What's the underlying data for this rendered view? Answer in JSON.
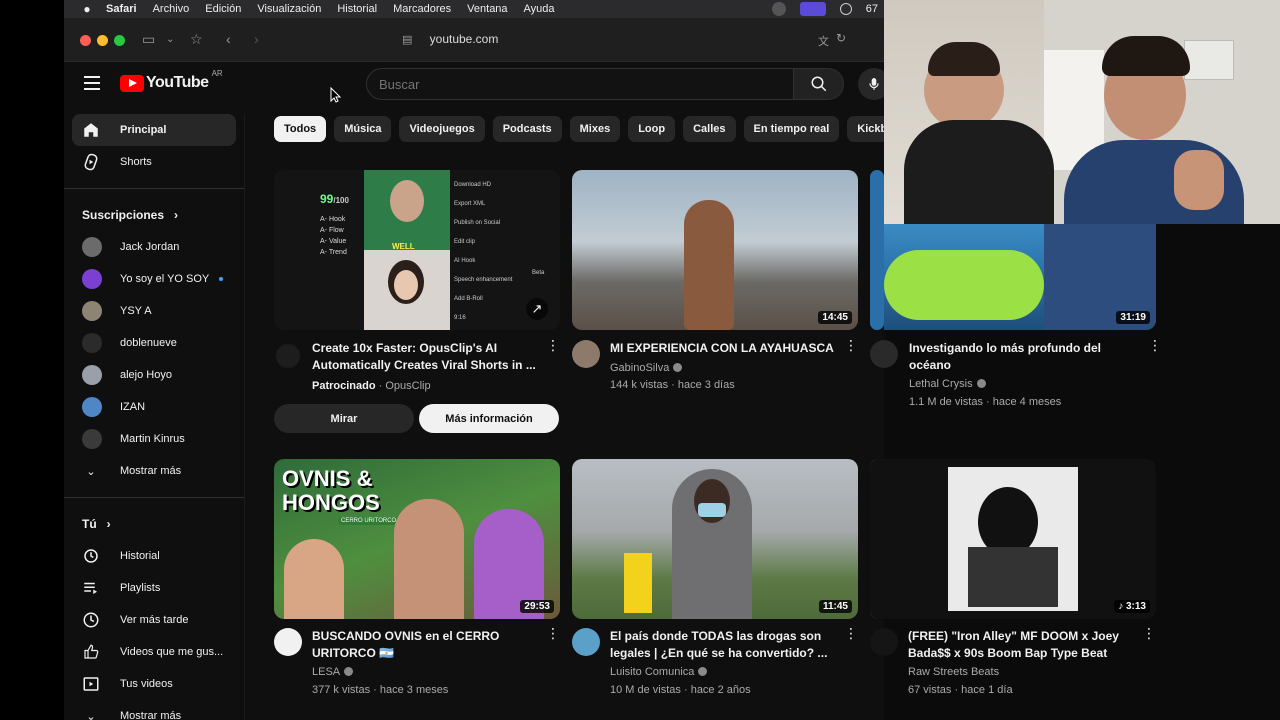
{
  "menubar": {
    "app": "Safari",
    "items": [
      "Archivo",
      "Edición",
      "Visualización",
      "Historial",
      "Marcadores",
      "Ventana",
      "Ayuda"
    ],
    "right_text": "67"
  },
  "browser": {
    "url": "youtube.com"
  },
  "youtube": {
    "logo_text": "YouTube",
    "region": "AR",
    "search_placeholder": "Buscar"
  },
  "sidebar": {
    "main": [
      {
        "label": "Principal",
        "icon": "home-icon",
        "active": true
      },
      {
        "label": "Shorts",
        "icon": "shorts-icon",
        "active": false
      }
    ],
    "subscriptions_title": "Suscripciones",
    "subscriptions": [
      {
        "label": "Jack Jordan",
        "color": "#6b6b6b"
      },
      {
        "label": "Yo soy el YO SOY",
        "color": "#7b3fd1",
        "new": true
      },
      {
        "label": "YSY A",
        "color": "#8c8573"
      },
      {
        "label": "doblenueve",
        "color": "#2b2b2b"
      },
      {
        "label": "alejo Hoyo",
        "color": "#9aa0a8"
      },
      {
        "label": "IZAN",
        "color": "#4f86c6"
      },
      {
        "label": "Martin Kinrus",
        "color": "#3a3a3a"
      }
    ],
    "show_more": "Mostrar más",
    "you_title": "Tú",
    "you_items": [
      {
        "label": "Historial",
        "icon": "history-icon"
      },
      {
        "label": "Playlists",
        "icon": "playlists-icon"
      },
      {
        "label": "Ver más tarde",
        "icon": "watch-later-icon"
      },
      {
        "label": "Videos que me gus...",
        "icon": "like-icon"
      },
      {
        "label": "Tus videos",
        "icon": "your-videos-icon"
      }
    ],
    "show_more_2": "Mostrar más"
  },
  "chips": [
    "Todos",
    "Música",
    "Videojuegos",
    "Podcasts",
    "Mixes",
    "Loop",
    "Calles",
    "En tiempo real",
    "Kickbo"
  ],
  "videos": [
    {
      "title": "Create 10x Faster: OpusClip's AI Automatically Creates Viral Shorts in ...",
      "sponsored": "Patrocinado",
      "channel": "OpusClip",
      "meta": "",
      "duration": "",
      "ad": true,
      "btn_watch": "Mirar",
      "btn_more": "Más información",
      "thumb_texts": {
        "score": "99",
        "score_total": "/100",
        "items": [
          "A- Hook",
          "A- Flow",
          "A- Value",
          "A- Trend"
        ],
        "menu": [
          "Download HD",
          "Export XML",
          "Publish on Social",
          "Edit clip",
          "AI Hook",
          "Speech enhancement",
          "Add B-Roll",
          "9:16"
        ],
        "beta": "Beta",
        "well": "WELL"
      }
    },
    {
      "title": "MI EXPERIENCIA CON LA AYAHUASCA",
      "channel": "GabinoSilva",
      "meta": "144 k vistas · hace 3 días",
      "duration": "14:45",
      "verified": true
    },
    {
      "title": "Investigando lo más profundo del océano",
      "channel": "Lethal Crysis",
      "meta": "1.1 M de vistas · hace 4 meses",
      "duration": "31:19",
      "verified": true
    },
    {
      "title": "BUSCANDO OVNIS en el CERRO URITORCO 🇦🇷",
      "channel": "LESA",
      "meta": "377 k vistas · hace 3 meses",
      "duration": "29:53",
      "verified": true,
      "thumb_text": "OVNIS & HONGOS",
      "thumb_sub": "CERRO URITORCO"
    },
    {
      "title": "El país donde TODAS las drogas son legales | ¿En qué se ha convertido? ...",
      "channel": "Luisito Comunica",
      "meta": "10 M de vistas · hace 2 años",
      "duration": "11:45",
      "verified": true
    },
    {
      "title": "(FREE) \"Iron Alley\" MF DOOM x Joey Bada$$ x 90s Boom Bap Type Beat",
      "channel": "Raw Streets Beats",
      "meta": "67 vistas · hace 1 día",
      "duration": "♪ 3:13"
    }
  ]
}
